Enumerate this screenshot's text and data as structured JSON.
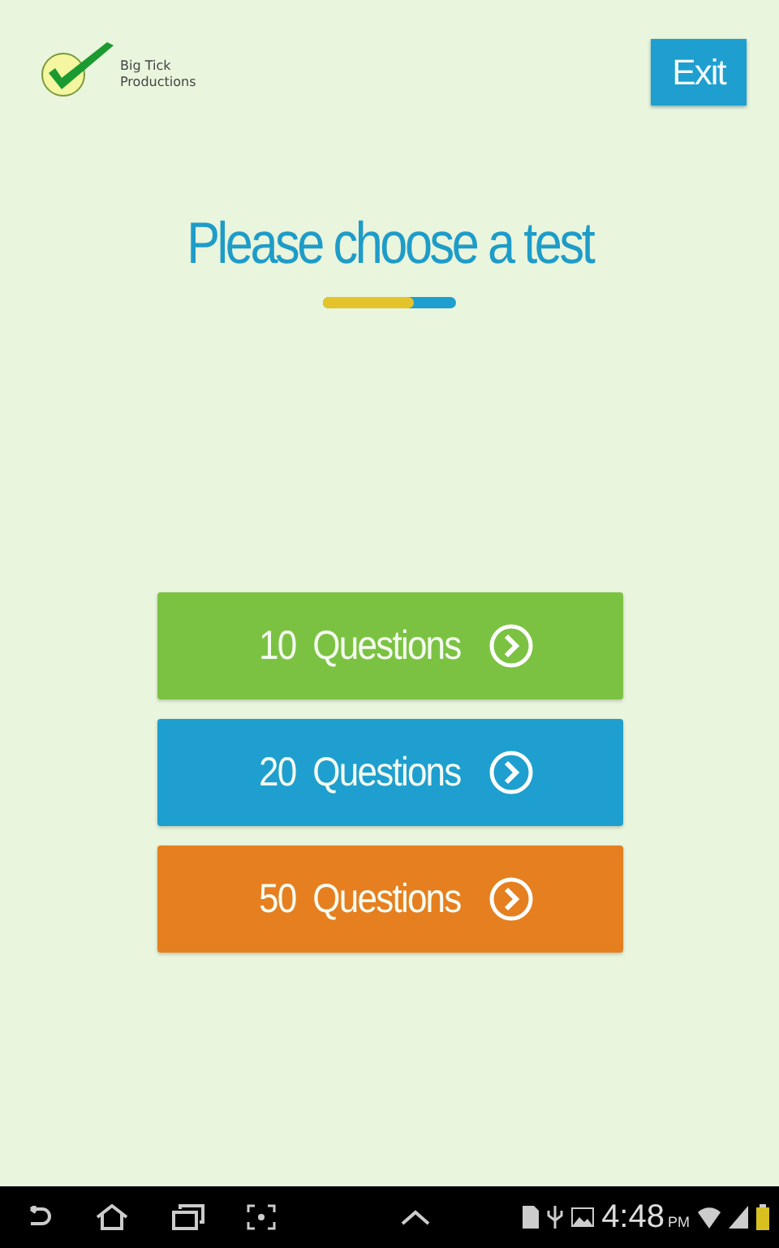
{
  "logo": {
    "line_1": "Big Tick",
    "line_2": "Productions"
  },
  "exit_button": {
    "label": "Exit"
  },
  "heading": "Please choose a test",
  "tests": [
    {
      "label": "10  Questions",
      "color": "#7cc242"
    },
    {
      "label": "20  Questions",
      "color": "#1e9fcf"
    },
    {
      "label": "50  Questions",
      "color": "#e67f1f"
    }
  ],
  "status_bar": {
    "time": "4:48",
    "ampm": "PM"
  }
}
